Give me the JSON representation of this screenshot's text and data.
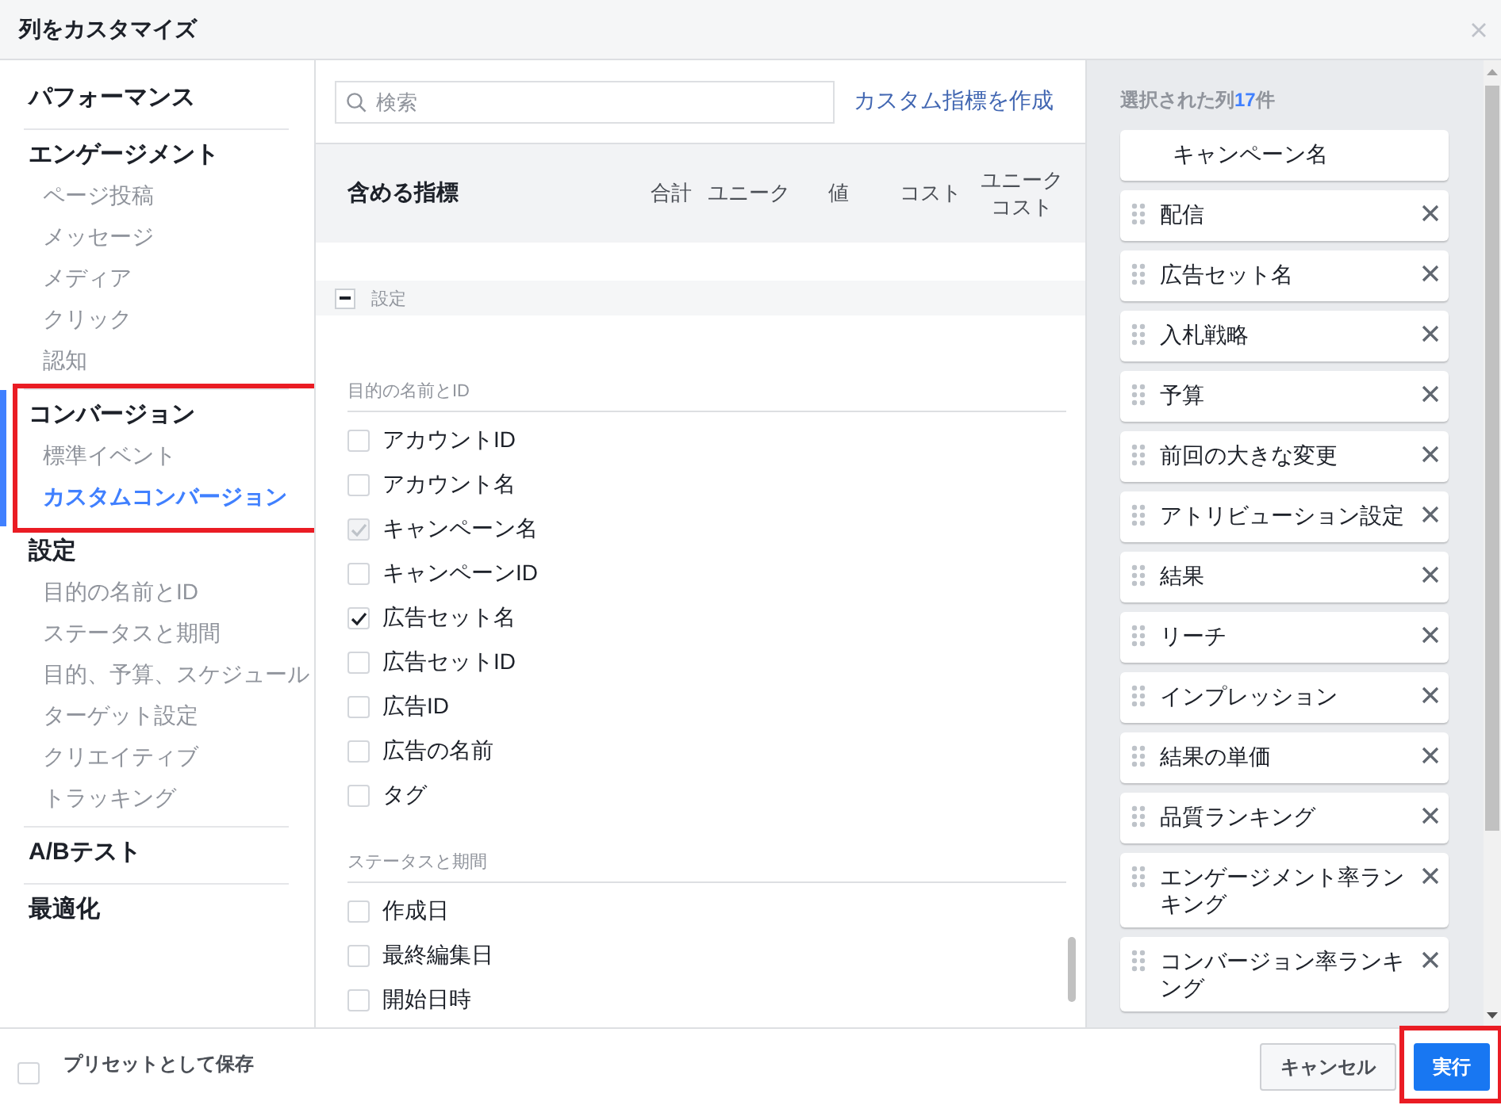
{
  "window": {
    "title": "列をカスタマイズ"
  },
  "sidebar": {
    "sections": [
      {
        "label": "パフォーマンス",
        "active": false,
        "highlighted": false
      },
      {
        "label": "エンゲージメント",
        "active": false,
        "highlighted": false,
        "items": [
          {
            "label": "ページ投稿",
            "selected": false
          },
          {
            "label": "メッセージ",
            "selected": false
          },
          {
            "label": "メディア",
            "selected": false
          },
          {
            "label": "クリック",
            "selected": false
          },
          {
            "label": "認知",
            "selected": false
          }
        ]
      },
      {
        "label": "コンバージョン",
        "active": true,
        "highlighted": true,
        "items": [
          {
            "label": "標準イベント",
            "selected": false
          },
          {
            "label": "カスタムコンバージョン",
            "selected": true
          }
        ]
      },
      {
        "label": "設定",
        "active": false,
        "highlighted": false,
        "items": [
          {
            "label": "目的の名前とID",
            "selected": false
          },
          {
            "label": "ステータスと期間",
            "selected": false
          },
          {
            "label": "目的、予算、スケジュール",
            "selected": false
          },
          {
            "label": "ターゲット設定",
            "selected": false
          },
          {
            "label": "クリエイティブ",
            "selected": false
          },
          {
            "label": "トラッキング",
            "selected": false
          }
        ]
      },
      {
        "label": "A/Bテスト",
        "active": false,
        "highlighted": false
      },
      {
        "label": "最適化",
        "active": false,
        "highlighted": false
      }
    ]
  },
  "metrics": {
    "search": {
      "placeholder": "検索"
    },
    "create_link": "カスタム指標を作成",
    "header": {
      "title": "含める指標",
      "columns": [
        "合計",
        "ユニーク",
        "値",
        "コスト",
        "ユニークコスト"
      ]
    },
    "section": {
      "label": "設定",
      "expanded": true,
      "groups": [
        {
          "label": "目的の名前とID",
          "items": [
            {
              "label": "アカウントID",
              "checked": false,
              "disabled": false
            },
            {
              "label": "アカウント名",
              "checked": false,
              "disabled": false
            },
            {
              "label": "キャンペーン名",
              "checked": true,
              "disabled": true
            },
            {
              "label": "キャンペーンID",
              "checked": false,
              "disabled": false
            },
            {
              "label": "広告セット名",
              "checked": true,
              "disabled": false
            },
            {
              "label": "広告セットID",
              "checked": false,
              "disabled": false
            },
            {
              "label": "広告ID",
              "checked": false,
              "disabled": false
            },
            {
              "label": "広告の名前",
              "checked": false,
              "disabled": false
            },
            {
              "label": "タグ",
              "checked": false,
              "disabled": false
            }
          ]
        },
        {
          "label": "ステータスと期間",
          "items": [
            {
              "label": "作成日",
              "checked": false,
              "disabled": false
            },
            {
              "label": "最終編集日",
              "checked": false,
              "disabled": false
            },
            {
              "label": "開始日時",
              "checked": false,
              "disabled": false
            }
          ]
        }
      ]
    }
  },
  "selected": {
    "title": "選択された列**17**件",
    "items": [
      {
        "label": "キャンペーン名",
        "kind": "fixed"
      },
      {
        "label": "配信",
        "kind": "removable"
      },
      {
        "label": "広告セット名",
        "kind": "removable"
      },
      {
        "label": "入札戦略",
        "kind": "removable"
      },
      {
        "label": "予算",
        "kind": "removable"
      },
      {
        "label": "前回の大きな変更",
        "kind": "removable"
      },
      {
        "label": "アトリビューション設定",
        "kind": "removable"
      },
      {
        "label": "結果",
        "kind": "removable"
      },
      {
        "label": "リーチ",
        "kind": "removable"
      },
      {
        "label": "インプレッション",
        "kind": "removable"
      },
      {
        "label": "結果の単価",
        "kind": "removable"
      },
      {
        "label": "品質ランキング",
        "kind": "removable"
      },
      {
        "label": "エンゲージメント率ランキング",
        "kind": "removable"
      },
      {
        "label": "コンバージョン率ランキング",
        "kind": "removable"
      }
    ]
  },
  "footer": {
    "preset": {
      "label": "プリセットとして保存",
      "checked": false
    },
    "buttons": [
      {
        "label": "キャンセル",
        "kind": "secondary",
        "highlighted": false
      },
      {
        "label": "実行",
        "kind": "primary",
        "highlighted": true
      }
    ]
  }
}
